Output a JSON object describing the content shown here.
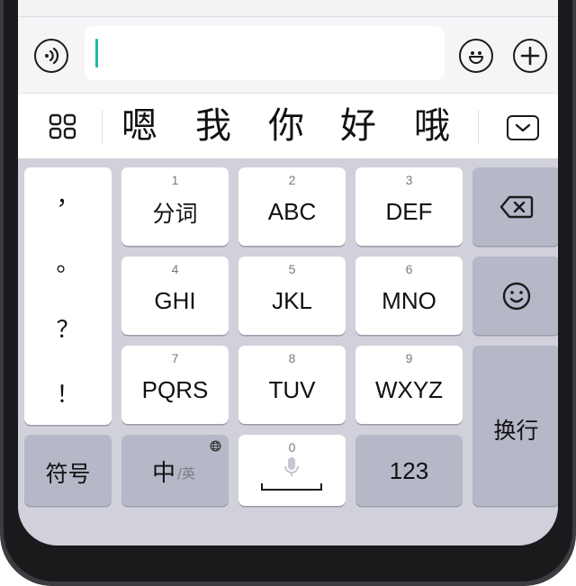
{
  "input_bar": {
    "voice_icon": "voice-wave-icon",
    "emoji_icon": "smiley-icon",
    "plus_icon": "plus-icon",
    "text_value": ""
  },
  "candidates": [
    "嗯",
    "我",
    "你",
    "好",
    "哦"
  ],
  "candidate_bar": {
    "menu_icon": "grid-icon",
    "collapse_icon": "keyboard-collapse-icon"
  },
  "keyboard": {
    "punctuation": [
      "，",
      "。",
      "？",
      "！"
    ],
    "t9_keys": [
      {
        "number": "1",
        "label": "分词"
      },
      {
        "number": "2",
        "label": "ABC"
      },
      {
        "number": "3",
        "label": "DEF"
      },
      {
        "number": "4",
        "label": "GHI"
      },
      {
        "number": "5",
        "label": "JKL"
      },
      {
        "number": "6",
        "label": "MNO"
      },
      {
        "number": "7",
        "label": "PQRS"
      },
      {
        "number": "8",
        "label": "TUV"
      },
      {
        "number": "9",
        "label": "WXYZ"
      }
    ],
    "symbols_label": "符号",
    "lang_main": "中",
    "lang_sub": "/英",
    "space_number": "0",
    "numbers_label": "123",
    "enter_label": "换行",
    "backspace_icon": "backspace-icon",
    "emoji_icon": "smiley-icon",
    "globe_icon": "globe-icon",
    "mic_icon": "microphone-icon"
  }
}
